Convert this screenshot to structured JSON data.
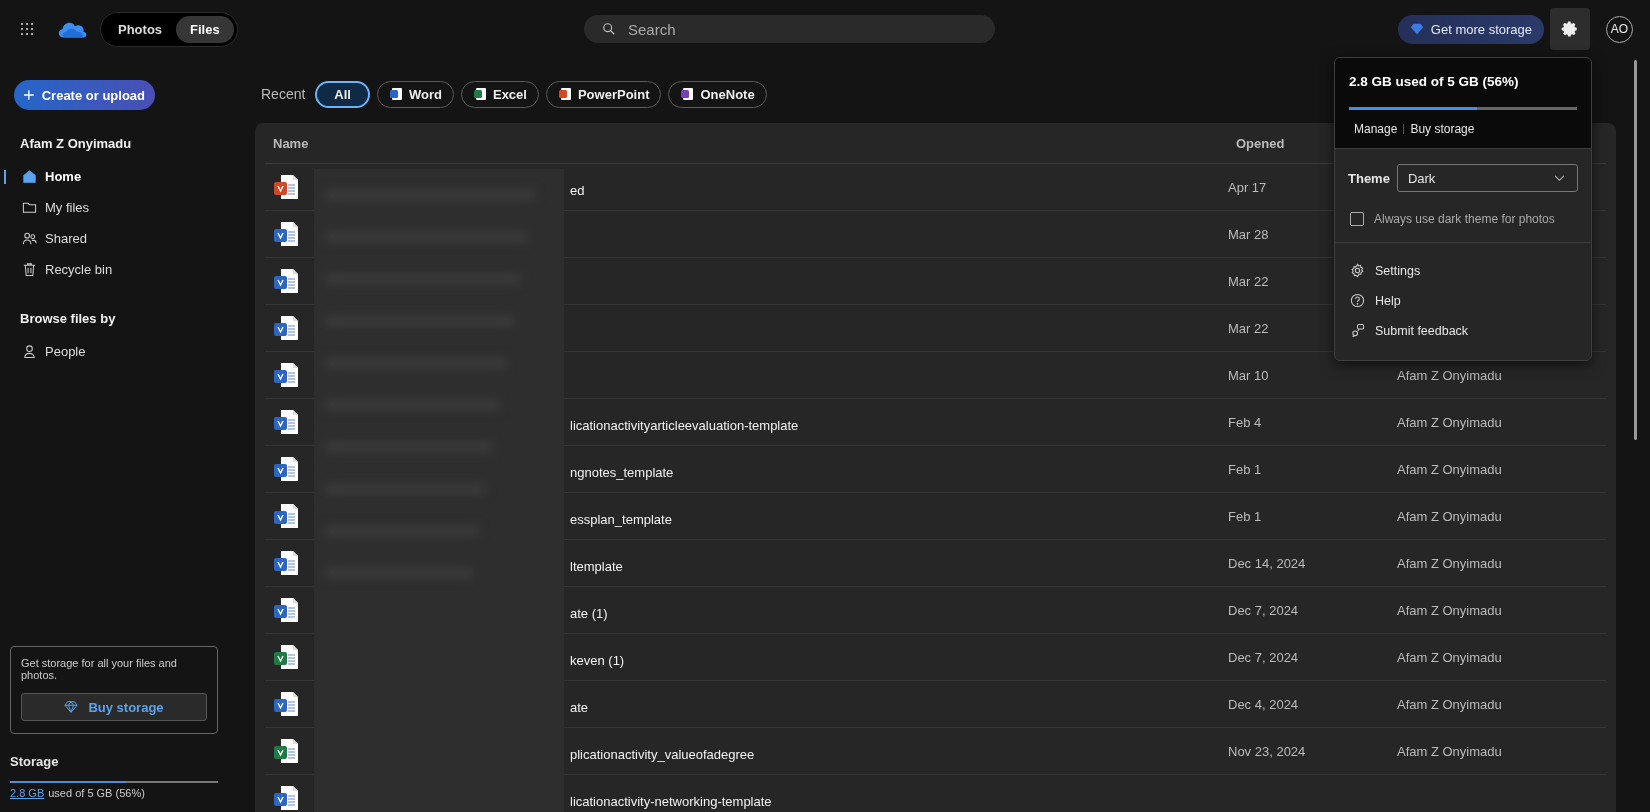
{
  "top_bar": {
    "view_toggle": [
      {
        "label": "Photos",
        "selected": false
      },
      {
        "label": "Files",
        "selected": true
      }
    ],
    "search": {
      "placeholder": "Search"
    },
    "get_storage_button": "Get more storage",
    "settings_open": true,
    "avatar": "AO"
  },
  "sidebar": {
    "create_button": "Create or upload",
    "user": "Afam Z Onyimadu",
    "nav": [
      {
        "label": "Home",
        "selected": true
      },
      {
        "label": "My files",
        "selected": false
      },
      {
        "label": "Shared",
        "selected": false
      },
      {
        "label": "Recycle bin",
        "selected": false
      }
    ],
    "browse_heading": "Browse files by",
    "browse": [
      {
        "label": "People",
        "selected": false
      }
    ],
    "promo": {
      "text": "Get storage for all your files and photos.",
      "button": "Buy storage"
    },
    "storage": {
      "title": "Storage",
      "used": "2.8 GB",
      "text": "used of 5 GB (56%)",
      "level": 0.56
    }
  },
  "filters": {
    "label": "Recent",
    "chips": [
      {
        "label": "All",
        "kind": "all",
        "selected": true
      },
      {
        "label": "Word",
        "kind": "word",
        "selected": false
      },
      {
        "label": "Excel",
        "kind": "excel",
        "selected": false
      },
      {
        "label": "PowerPoint",
        "kind": "powerpoint",
        "selected": false
      },
      {
        "label": "OneNote",
        "kind": "onenote",
        "selected": false
      }
    ]
  },
  "table": {
    "columns": [
      "Name",
      "Opened"
    ],
    "rows": [
      {
        "kind": "powerpoint",
        "name": "ed",
        "opened": "Apr 17"
      },
      {
        "kind": "word",
        "opened": "Mar 28"
      },
      {
        "kind": "word",
        "opened": "Mar 22"
      },
      {
        "kind": "word",
        "opened": "Mar 22"
      },
      {
        "kind": "word",
        "opened": "Mar 10",
        "owner": "Afam Z Onyimadu"
      },
      {
        "kind": "word",
        "name": "licationactivityarticleevaluation-template",
        "opened": "Feb 4",
        "owner": "Afam Z Onyimadu"
      },
      {
        "kind": "word",
        "name": "ngnotes_template",
        "opened": "Feb 1",
        "owner": "Afam Z Onyimadu"
      },
      {
        "kind": "word",
        "name": "essplan_template",
        "opened": "Feb 1",
        "owner": "Afam Z Onyimadu"
      },
      {
        "kind": "word",
        "name": "ltemplate",
        "opened": "Dec 14, 2024",
        "owner": "Afam Z Onyimadu"
      },
      {
        "kind": "word",
        "name": "ate (1)",
        "opened": "Dec 7, 2024",
        "owner": "Afam Z Onyimadu"
      },
      {
        "kind": "excel",
        "name": "keven (1)",
        "opened": "Dec 7, 2024",
        "owner": "Afam Z Onyimadu"
      },
      {
        "kind": "word",
        "name": "ate",
        "opened": "Dec 4, 2024",
        "owner": "Afam Z Onyimadu"
      },
      {
        "kind": "excel",
        "name": "plicationactivity_valueofadegree",
        "opened": "Nov 23, 2024",
        "owner": "Afam Z Onyimadu"
      },
      {
        "kind": "word",
        "name": "licationactivity-networking-template"
      }
    ]
  },
  "settings_menu": {
    "usage": "2.8 GB used of 5 GB (56%)",
    "level": 0.56,
    "links": [
      "Manage",
      "Buy storage"
    ],
    "theme_label": "Theme",
    "theme_value": "Dark",
    "dark_photos": {
      "label": "Always use dark theme for photos",
      "checked": false
    },
    "items": [
      "Settings",
      "Help",
      "Submit feedback"
    ]
  }
}
